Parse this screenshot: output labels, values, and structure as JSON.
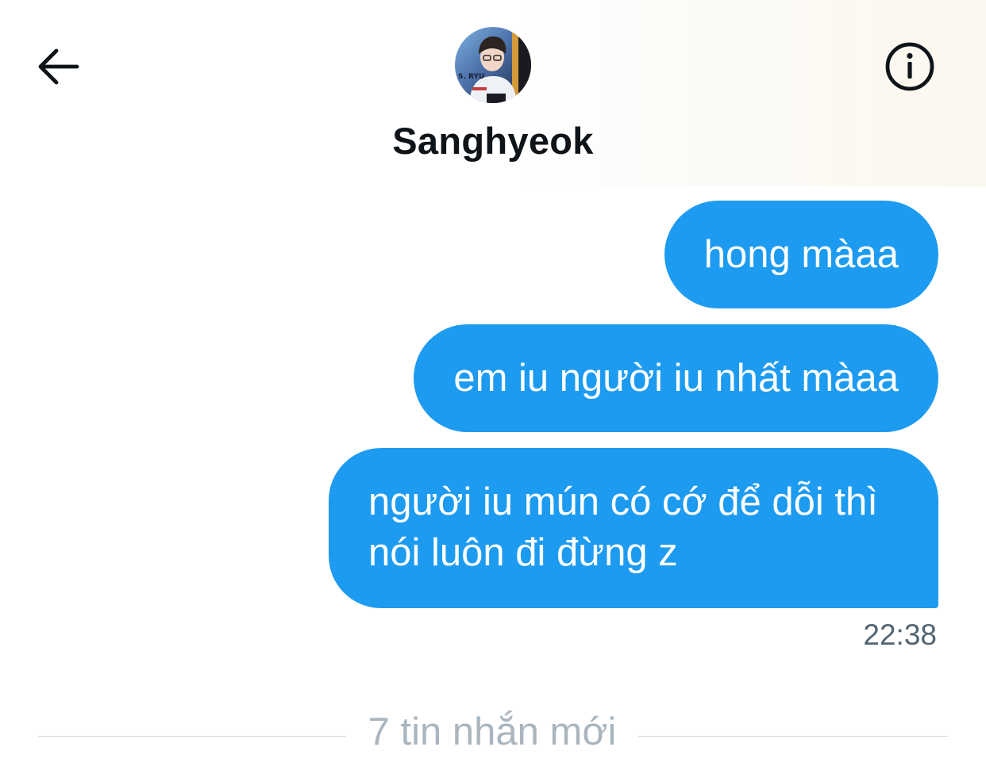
{
  "header": {
    "contact_name": "Sanghyeok",
    "avatar_caption": "S. RYU",
    "back_icon": "arrow-left-icon",
    "info_icon": "info-circle-icon"
  },
  "messages": [
    {
      "text": "hong màaa",
      "direction": "outgoing"
    },
    {
      "text": "em iu người iu nhất màaa",
      "direction": "outgoing"
    },
    {
      "text": "người iu mún có cớ để dỗi thì nói luôn đi đừng z",
      "direction": "outgoing"
    }
  ],
  "last_message_time": "22:38",
  "new_messages_divider": "7 tin nhắn mới",
  "colors": {
    "bubble": "#1d9bf0",
    "bubble_text": "#ffffff",
    "timestamp": "#536471",
    "divider_text": "#a9b6c0",
    "divider_line": "#cfd9de"
  }
}
